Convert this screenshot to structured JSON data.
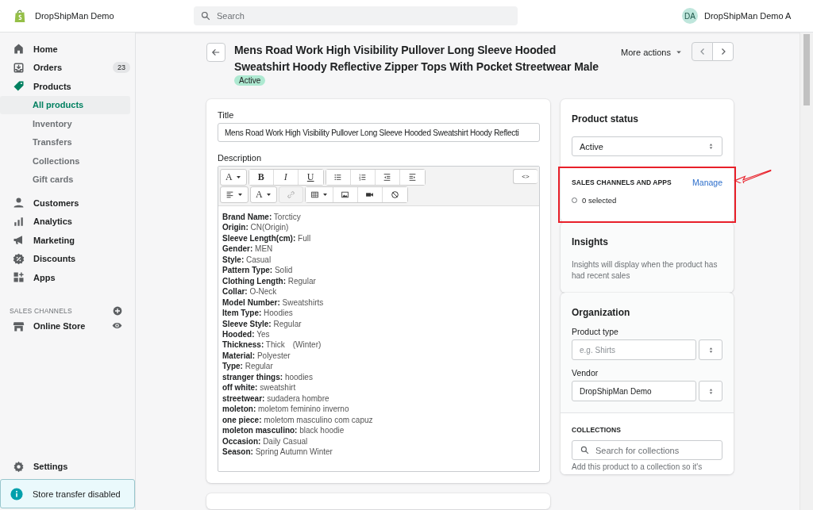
{
  "topbar": {
    "store_name": "DropShipMan Demo",
    "search_placeholder": "Search",
    "avatar_initials": "DA",
    "user_name": "DropShipMan Demo A"
  },
  "sidebar": {
    "items": [
      {
        "label": "Home",
        "expanded": false
      },
      {
        "label": "Orders",
        "badge": "23",
        "expanded": false
      },
      {
        "label": "Products",
        "expanded": true,
        "children": [
          {
            "label": "All products",
            "selected": true
          },
          {
            "label": "Inventory",
            "selected": false
          },
          {
            "label": "Transfers",
            "selected": false
          },
          {
            "label": "Collections",
            "selected": false
          },
          {
            "label": "Gift cards",
            "selected": false
          }
        ]
      },
      {
        "label": "Customers",
        "expanded": false
      },
      {
        "label": "Analytics",
        "expanded": false
      },
      {
        "label": "Marketing",
        "expanded": false
      },
      {
        "label": "Discounts",
        "expanded": false
      },
      {
        "label": "Apps",
        "expanded": false
      }
    ],
    "sales_channels_heading": "SALES CHANNELS",
    "channels": [
      {
        "label": "Online Store"
      }
    ],
    "settings": "Settings",
    "notice": "Store transfer disabled"
  },
  "header": {
    "title": "Mens Road Work High Visibility Pullover Long Sleeve Hooded Sweatshirt Hoody Reflective Zipper Tops With Pocket Streetwear Male",
    "status_badge": "Active",
    "more_actions": "More actions"
  },
  "editor": {
    "title_label": "Title",
    "title_value": "Mens Road Work High Visibility Pullover Long Sleeve Hooded Sweatshirt Hoody Reflecti",
    "description_label": "Description",
    "toolbar_rows": [
      [
        {
          "kind": "text",
          "label": "A",
          "dropdown": true,
          "disabled": false
        },
        {
          "kind": "text",
          "label": "B",
          "dropdown": false,
          "disabled": false
        },
        {
          "kind": "text",
          "label": "I",
          "dropdown": false,
          "disabled": false
        },
        {
          "kind": "text",
          "label": "U",
          "dropdown": false,
          "disabled": false
        },
        {
          "kind": "icon",
          "dropdown": false,
          "disabled": false
        },
        {
          "kind": "icon",
          "dropdown": false,
          "disabled": false
        },
        {
          "kind": "icon",
          "dropdown": false,
          "disabled": false
        },
        {
          "kind": "icon",
          "dropdown": false,
          "disabled": false
        }
      ],
      [
        {
          "kind": "icon",
          "dropdown": true,
          "disabled": false
        },
        {
          "kind": "text",
          "label": "A",
          "dropdown": true,
          "disabled": false
        },
        {
          "kind": "icon",
          "dropdown": false,
          "disabled": true
        },
        {
          "kind": "icon",
          "dropdown": true,
          "disabled": false
        },
        {
          "kind": "icon",
          "dropdown": false,
          "disabled": false
        },
        {
          "kind": "icon",
          "dropdown": false,
          "disabled": false
        },
        {
          "kind": "icon",
          "dropdown": false,
          "disabled": false
        }
      ]
    ],
    "code_button": "<>",
    "lines": [
      "**Brand Name:** Torcticy",
      "**Origin:** CN(Origin)",
      "**Sleeve Length(cm):** Full",
      "**Gender:** MEN",
      "**Style:** Casual",
      "**Pattern Type:** Solid",
      "**Clothing Length:** Regular",
      "**Collar:** O-Neck",
      "**Model Number:** Sweatshirts",
      "**Item Type:** Hoodies",
      "**Sleeve Style:** Regular",
      "**Hooded:** Yes",
      "**Thickness:** Thick　(Winter)",
      "**Material:** Polyester",
      "**Type:** Regular",
      "**stranger things:** hoodies",
      "**off white:** sweatshirt",
      "**streetwear:** sudadera hombre",
      "**moleton:** moletom feminino inverno",
      "**one piece:** moletom masculino com capuz",
      "**moleton masculino:** black hoodie",
      "**Occasion:** Daily Casual",
      "**Season:** Spring Autumn Winter"
    ]
  },
  "product_status": {
    "heading": "Product status",
    "value": "Active"
  },
  "sales_channels": {
    "heading": "SALES CHANNELS AND APPS",
    "action": "Manage",
    "summary": "0 selected",
    "highlighted": true
  },
  "insights": {
    "heading": "Insights",
    "text": "Insights will display when the product has had recent sales"
  },
  "organization": {
    "heading": "Organization",
    "fields": [
      {
        "label": "Product type",
        "placeholder": "e.g. Shirts"
      },
      {
        "label": "Vendor",
        "value": "DropShipMan Demo"
      }
    ]
  },
  "collections": {
    "heading": "COLLECTIONS",
    "placeholder": "Search for collections",
    "note": "Add this product to a collection so it's"
  }
}
